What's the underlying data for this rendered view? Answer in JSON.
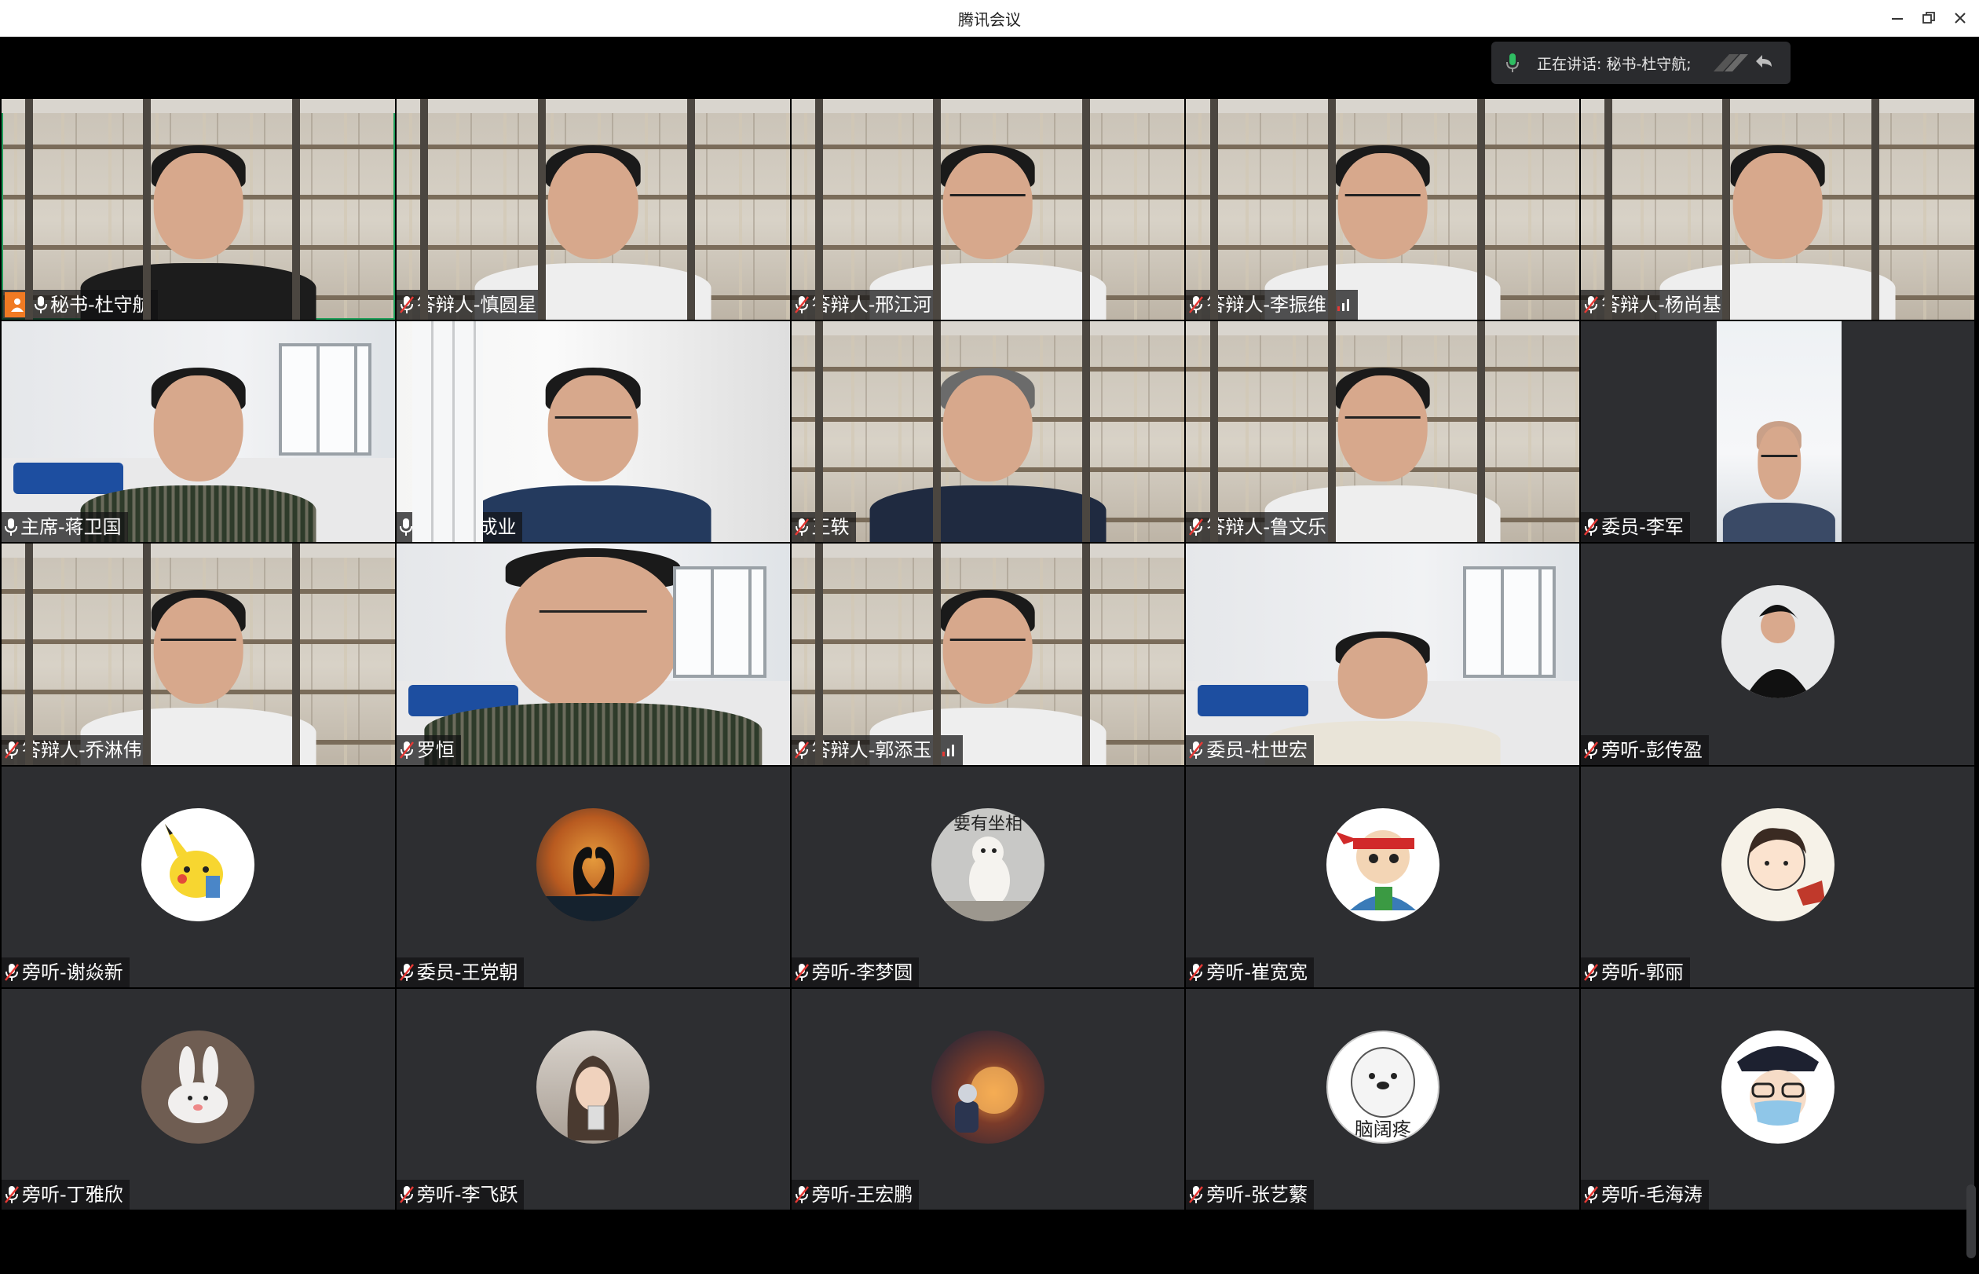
{
  "window": {
    "title": "腾讯会议"
  },
  "speaking": {
    "text": "正在讲话: 秘书-杜守航;"
  },
  "colors": {
    "accent": "#1f9e5a",
    "host_badge": "#f07a23",
    "tile_bg": "#2d2e31"
  },
  "participants": [
    {
      "name": "秘书-杜守航",
      "mic": "on",
      "host": true
    },
    {
      "name": "答辩人-慎圆星",
      "mic": "muted"
    },
    {
      "name": "答辩人-邢江河",
      "mic": "muted"
    },
    {
      "name": "答辩人-李振维",
      "mic": "muted",
      "signal": true
    },
    {
      "name": "答辩人-杨尚基",
      "mic": "muted"
    },
    {
      "name": "主席-蒋卫国",
      "mic": "on"
    },
    {
      "name": "委员-张成业",
      "mic": "on"
    },
    {
      "name": "王轶",
      "mic": "muted"
    },
    {
      "name": "答辩人-鲁文乐",
      "mic": "muted"
    },
    {
      "name": "委员-李军",
      "mic": "muted"
    },
    {
      "name": "答辩人-乔淋伟",
      "mic": "muted"
    },
    {
      "name": "罗恒",
      "mic": "muted"
    },
    {
      "name": "答辩人-郭添玉",
      "mic": "muted",
      "signal": true
    },
    {
      "name": "委员-杜世宏",
      "mic": "muted"
    },
    {
      "name": "旁听-彭传盈",
      "mic": "muted"
    },
    {
      "name": "旁听-谢焱新",
      "mic": "muted"
    },
    {
      "name": "委员-王党朝",
      "mic": "muted"
    },
    {
      "name": "旁听-李梦圆",
      "mic": "muted",
      "avatar_text": "要有坐相"
    },
    {
      "name": "旁听-崔宽宽",
      "mic": "muted"
    },
    {
      "name": "旁听-郭丽",
      "mic": "muted"
    },
    {
      "name": "旁听-丁雅欣",
      "mic": "muted"
    },
    {
      "name": "旁听-李飞跃",
      "mic": "muted"
    },
    {
      "name": "旁听-王宏鹏",
      "mic": "muted"
    },
    {
      "name": "旁听-张艺蘩",
      "mic": "muted",
      "avatar_text": "脑阔疼"
    },
    {
      "name": "旁听-毛海涛",
      "mic": "muted"
    }
  ]
}
